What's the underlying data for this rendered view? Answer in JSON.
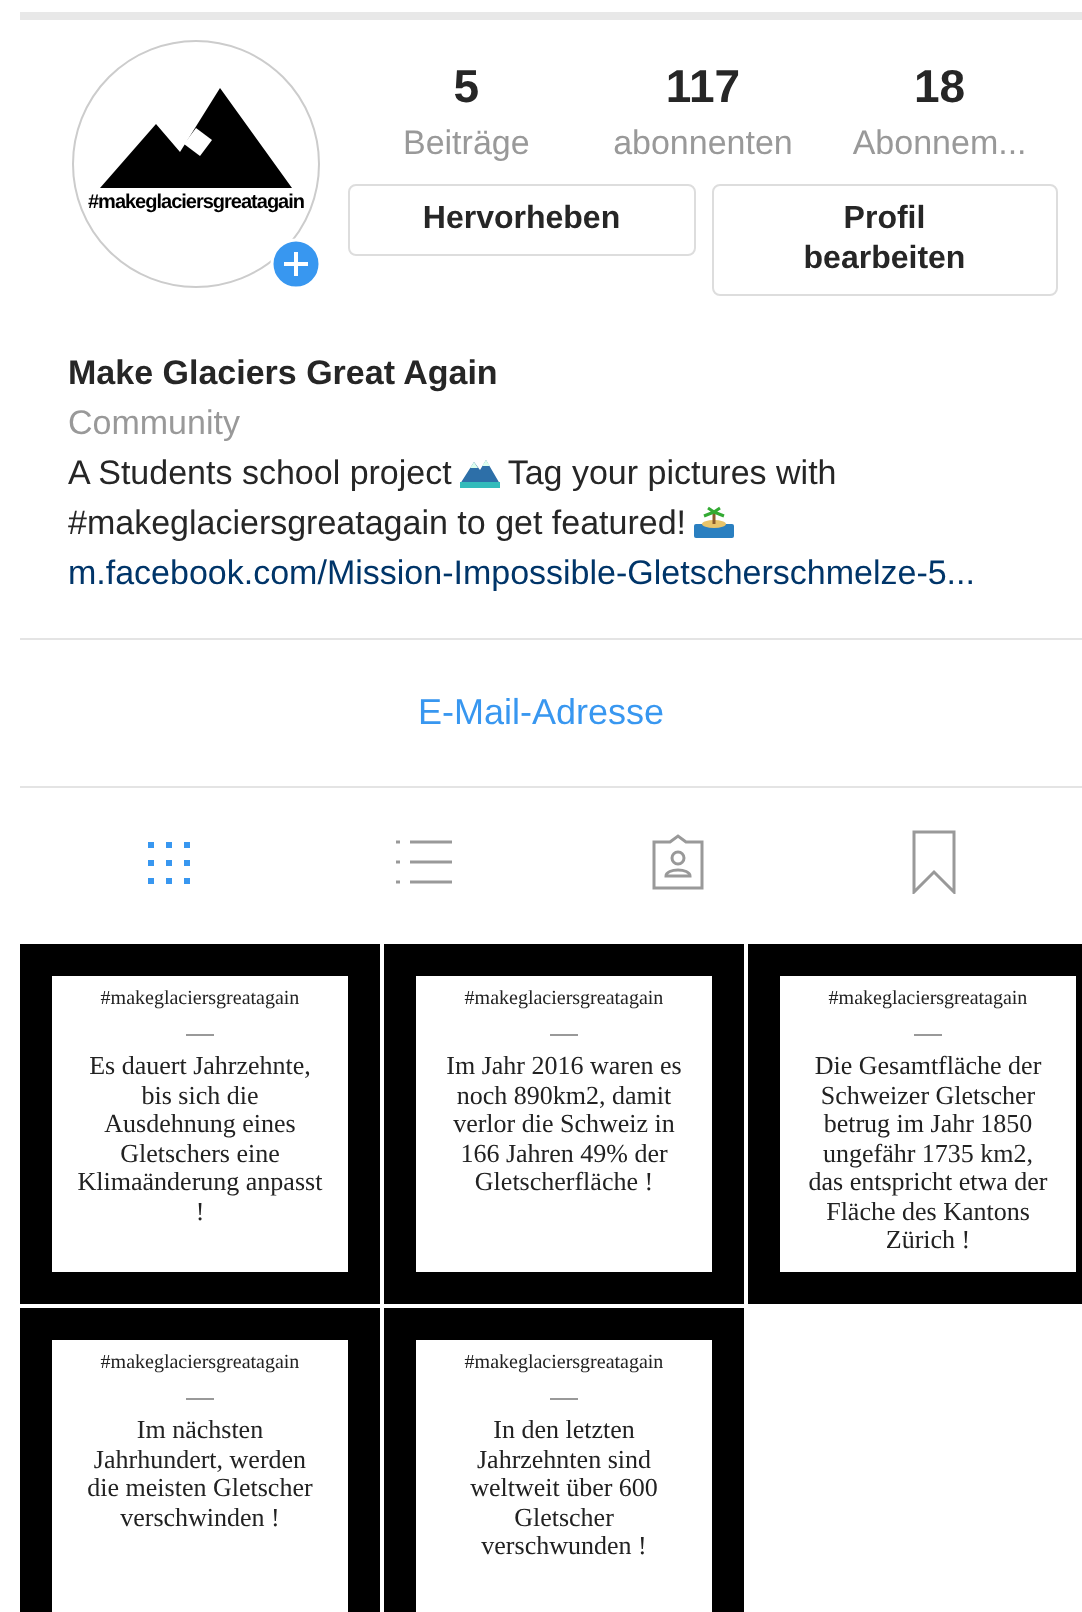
{
  "profile": {
    "avatar_caption": "#makeglaciersgreatagain",
    "stats": [
      {
        "count": "5",
        "label": "Beiträge"
      },
      {
        "count": "117",
        "label": "abonnenten"
      },
      {
        "count": "18",
        "label": "Abonnem..."
      }
    ],
    "buttons": [
      "Hervorheben",
      "Profil bearbeiten"
    ]
  },
  "bio": {
    "name": "Make Glaciers Great Again",
    "category": "Community",
    "text_1": "A Students school project",
    "text_2": "Tag your pictures with",
    "text_3": "#makeglaciersgreatagain to get featured!",
    "link": "m.facebook.com/Mission-Impossible-Gletscherschmelze-5..."
  },
  "contact": "E-Mail-Adresse",
  "tabs": [
    {
      "kind": "grid",
      "selected": true
    },
    {
      "kind": "list",
      "selected": false
    },
    {
      "kind": "tagged",
      "selected": false
    },
    {
      "kind": "saved",
      "selected": false
    }
  ],
  "posts": [
    {
      "tag": "#makeglaciersgreatagain",
      "text": "Es dauert Jahrzehnte, bis sich die Ausdehnung eines Gletschers eine Klimaänderung anpasst !"
    },
    {
      "tag": "#makeglaciersgreatagain",
      "text": "Im Jahr 2016 waren es noch 890km2, damit verlor die Schweiz in 166 Jahren 49% der Gletscherfläche !"
    },
    {
      "tag": "#makeglaciersgreatagain",
      "text": "Die Gesamtfläche der Schweizer Gletscher betrug im Jahr 1850 ungefähr 1735 km2, das entspricht etwa der Fläche des Kantons Zürich !"
    },
    {
      "tag": "#makeglaciersgreatagain",
      "text": "Im nächsten Jahrhundert, werden die meisten Gletscher verschwinden !"
    },
    {
      "tag": "#makeglaciersgreatagain",
      "text": "In den letzten Jahrzehnten sind weltweit über 600 Gletscher verschwunden !"
    }
  ]
}
